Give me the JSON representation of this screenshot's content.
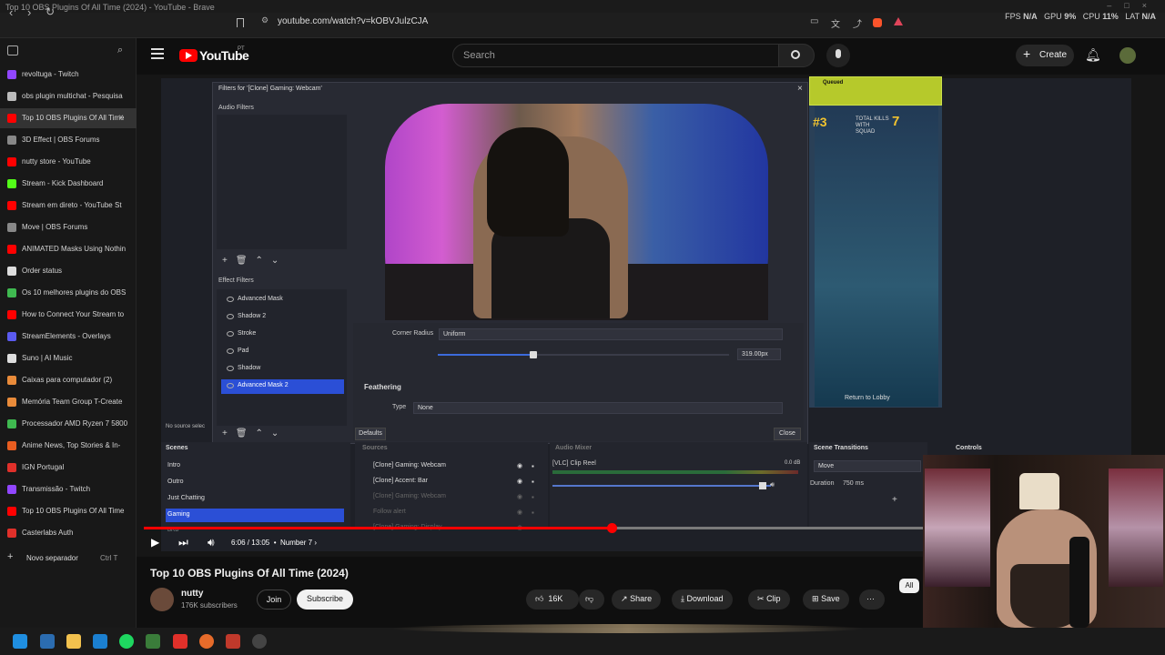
{
  "window": {
    "title": "Top 10 OBS Plugins Of All Time (2024) - YouTube - Brave"
  },
  "browser": {
    "url": "youtube.com/watch?v=kOBVJulzCJA",
    "sysstats": {
      "fps_label": "FPS",
      "fps": "N/A",
      "gpu_label": "GPU",
      "gpu": "9%",
      "cpu_label": "CPU",
      "cpu": "11%",
      "lat_label": "LAT",
      "lat": "N/A"
    }
  },
  "sidebar": {
    "tabs": [
      {
        "label": "revoltuga - Twitch",
        "color": "#9146ff"
      },
      {
        "label": "obs plugin multichat - Pesquisa",
        "color": "#bbbbbb"
      },
      {
        "label": "Top 10 OBS Plugins Of All Time",
        "color": "#ff0000",
        "active": true
      },
      {
        "label": "3D Effect | OBS Forums",
        "color": "#888888"
      },
      {
        "label": "nutty store - YouTube",
        "color": "#ff0000"
      },
      {
        "label": "Stream - Kick Dashboard",
        "color": "#53fc18"
      },
      {
        "label": "Stream em direto - YouTube St",
        "color": "#ff0000"
      },
      {
        "label": "Move | OBS Forums",
        "color": "#888888"
      },
      {
        "label": "ANIMATED Masks Using Nothin",
        "color": "#ff0000"
      },
      {
        "label": "Order status",
        "color": "#dddddd"
      },
      {
        "label": "Os 10 melhores plugins do OBS",
        "color": "#3fb950"
      },
      {
        "label": "How to Connect Your Stream to",
        "color": "#ff0000"
      },
      {
        "label": "StreamElements - Overlays",
        "color": "#5b5bf0"
      },
      {
        "label": "Suno | AI Music",
        "color": "#dddddd"
      },
      {
        "label": "Caixas para computador (2)",
        "color": "#e98b3a"
      },
      {
        "label": "Memória Team Group T-Create",
        "color": "#e98b3a"
      },
      {
        "label": "Processador AMD Ryzen 7 5800",
        "color": "#3fb950"
      },
      {
        "label": "Anime News, Top Stories & In-",
        "color": "#e85d20"
      },
      {
        "label": "IGN Portugal",
        "color": "#e0302a"
      },
      {
        "label": "Transmissão - Twitch",
        "color": "#9146ff"
      },
      {
        "label": "Top 10 OBS Plugins Of All Time",
        "color": "#ff0000"
      },
      {
        "label": "Casterlabs Auth",
        "color": "#e0302a"
      }
    ],
    "new_separator": "Novo separador",
    "shortcut": "Ctrl T"
  },
  "youtube": {
    "logo_text": "YouTube",
    "logo_country": "PT",
    "search_placeholder": "Search",
    "create_label": "Create"
  },
  "obs": {
    "dialog_title": "Filters for '[Clone] Gaming: Webcam'",
    "audio_filters_label": "Audio Filters",
    "effect_filters_label": "Effect Filters",
    "effect_filters": [
      "Advanced Mask",
      "Shadow 2",
      "Stroke",
      "Pad",
      "Shadow",
      "Advanced Mask 2"
    ],
    "corner_radius_label": "Corner Radius",
    "corner_radius_value": "Uniform",
    "slider_value": "319.00px",
    "feathering_label": "Feathering",
    "type_label": "Type",
    "type_value": "None",
    "defaults_label": "Defaults",
    "close_label": "Close",
    "no_source": "No source selec",
    "scenes_title": "Scenes",
    "scenes": [
      "Intro",
      "Outro",
      "Just Chatting",
      "Gaming",
      "BRB"
    ],
    "sources_title": "Sources",
    "sources": [
      "[Clone] Gaming: Webcam",
      "[Clone] Accent: Bar",
      "[Clone] Gaming: Webcam",
      "Follow alert",
      "[Clone] Gaming: Display"
    ],
    "audio_title": "Audio Mixer",
    "audio_track": "[VLC] Clip Reel",
    "audio_db": "0.0 dB",
    "transitions_title": "Scene Transitions",
    "transition_value": "Move",
    "duration_label": "Duration",
    "duration_value": "750 ms",
    "controls_title": "Controls",
    "game_queued": "Queued",
    "game_rank": "#3",
    "game_kills_label": "TOTAL KILLS WITH SQUAD",
    "game_kills": "7",
    "game_return": "Return to Lobby"
  },
  "player": {
    "time": "6:06 / 13:05",
    "chapter": "Number 7",
    "progress": 0.6
  },
  "video": {
    "title": "Top 10 OBS Plugins Of All Time (2024)",
    "channel": "nutty",
    "subscribers": "176K subscribers",
    "join": "Join",
    "subscribe": "Subscribe",
    "likes": "16K",
    "share": "Share",
    "download": "Download",
    "clip": "Clip",
    "save": "Save",
    "more": "···",
    "chip_all": "All"
  }
}
